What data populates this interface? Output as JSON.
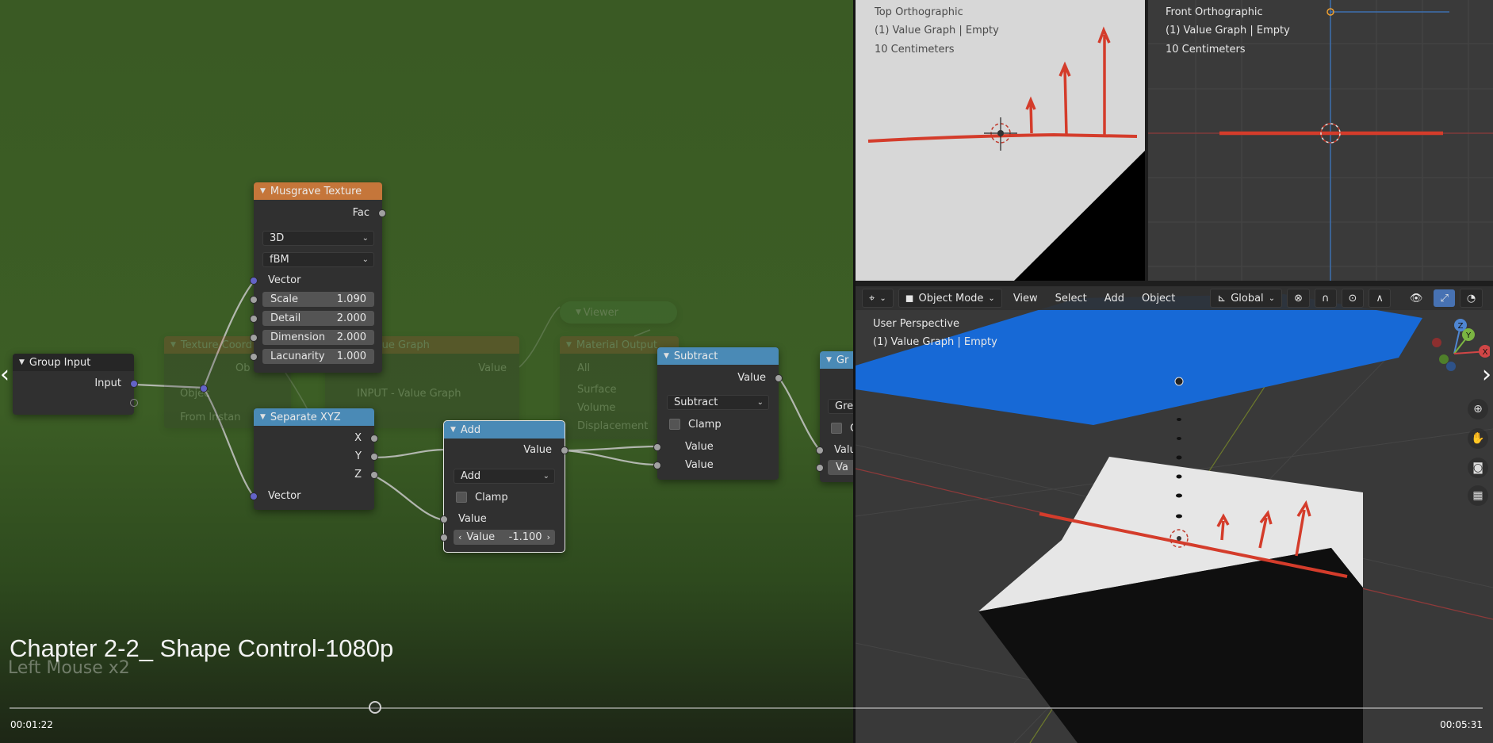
{
  "video": {
    "title": "Chapter 2-2_ Shape Control-1080p",
    "key_hint": "Left Mouse x2",
    "current_time": "00:01:22",
    "duration": "00:05:31",
    "progress": 0.248
  },
  "nodes": {
    "group_input": {
      "title": "Group Input",
      "input_label": "Input"
    },
    "musgrave": {
      "title": "Musgrave Texture",
      "fac_label": "Fac",
      "dimensions": "3D",
      "type": "fBM",
      "vector_label": "Vector",
      "fields": [
        {
          "label": "Scale",
          "value": "1.090"
        },
        {
          "label": "Detail",
          "value": "2.000"
        },
        {
          "label": "Dimension",
          "value": "2.000"
        },
        {
          "label": "Lacunarity",
          "value": "1.000"
        }
      ]
    },
    "separate_xyz": {
      "title": "Separate XYZ",
      "x_label": "X",
      "y_label": "Y",
      "z_label": "Z",
      "vector_label": "Vector"
    },
    "add": {
      "title": "Add",
      "output_label": "Value",
      "operation": "Add",
      "clamp_label": "Clamp",
      "input_label": "Value",
      "field_label": "Value",
      "field_value": "-1.100"
    },
    "subtract": {
      "title": "Subtract",
      "output_label": "Value",
      "operation": "Subtract",
      "clamp_label": "Clamp",
      "input1_label": "Value",
      "input2_label": "Value"
    },
    "greater": {
      "title": "Gr",
      "op_partial": "Gre",
      "clamp_partial": "C",
      "value_partial": "Valu",
      "field_partial": "Va"
    },
    "ghost_texture": {
      "title": "Texture Coord",
      "obj_label": "Ob",
      "object_label": "Objec",
      "from_instancer": "From Instan"
    },
    "ghost_value_graph": {
      "title": "lue Graph",
      "value_label": "Value",
      "object_value": "INPUT - Value Graph"
    },
    "ghost_viewer": {
      "title": "Viewer"
    },
    "ghost_material": {
      "title": "Material Output",
      "target": "All",
      "surface": "Surface",
      "volume": "Volume",
      "displacement": "Displacement"
    }
  },
  "viewport_top": {
    "view": "Top Orthographic",
    "object": "(1) Value Graph | Empty",
    "scale": "10 Centimeters"
  },
  "viewport_front": {
    "view": "Front Orthographic",
    "object": "(1) Value Graph | Empty",
    "scale": "10 Centimeters"
  },
  "viewport_persp": {
    "view": "User Perspective",
    "object": "(1) Value Graph | Empty",
    "header": {
      "mode": "Object Mode",
      "menu": [
        "View",
        "Select",
        "Add",
        "Object"
      ],
      "orientation": "Global"
    },
    "gizmo": {
      "z": "Z",
      "y": "Y",
      "x": "X"
    },
    "tools": [
      "zoom-icon",
      "hand-pan-icon",
      "camera-icon",
      "grid-icon"
    ]
  }
}
